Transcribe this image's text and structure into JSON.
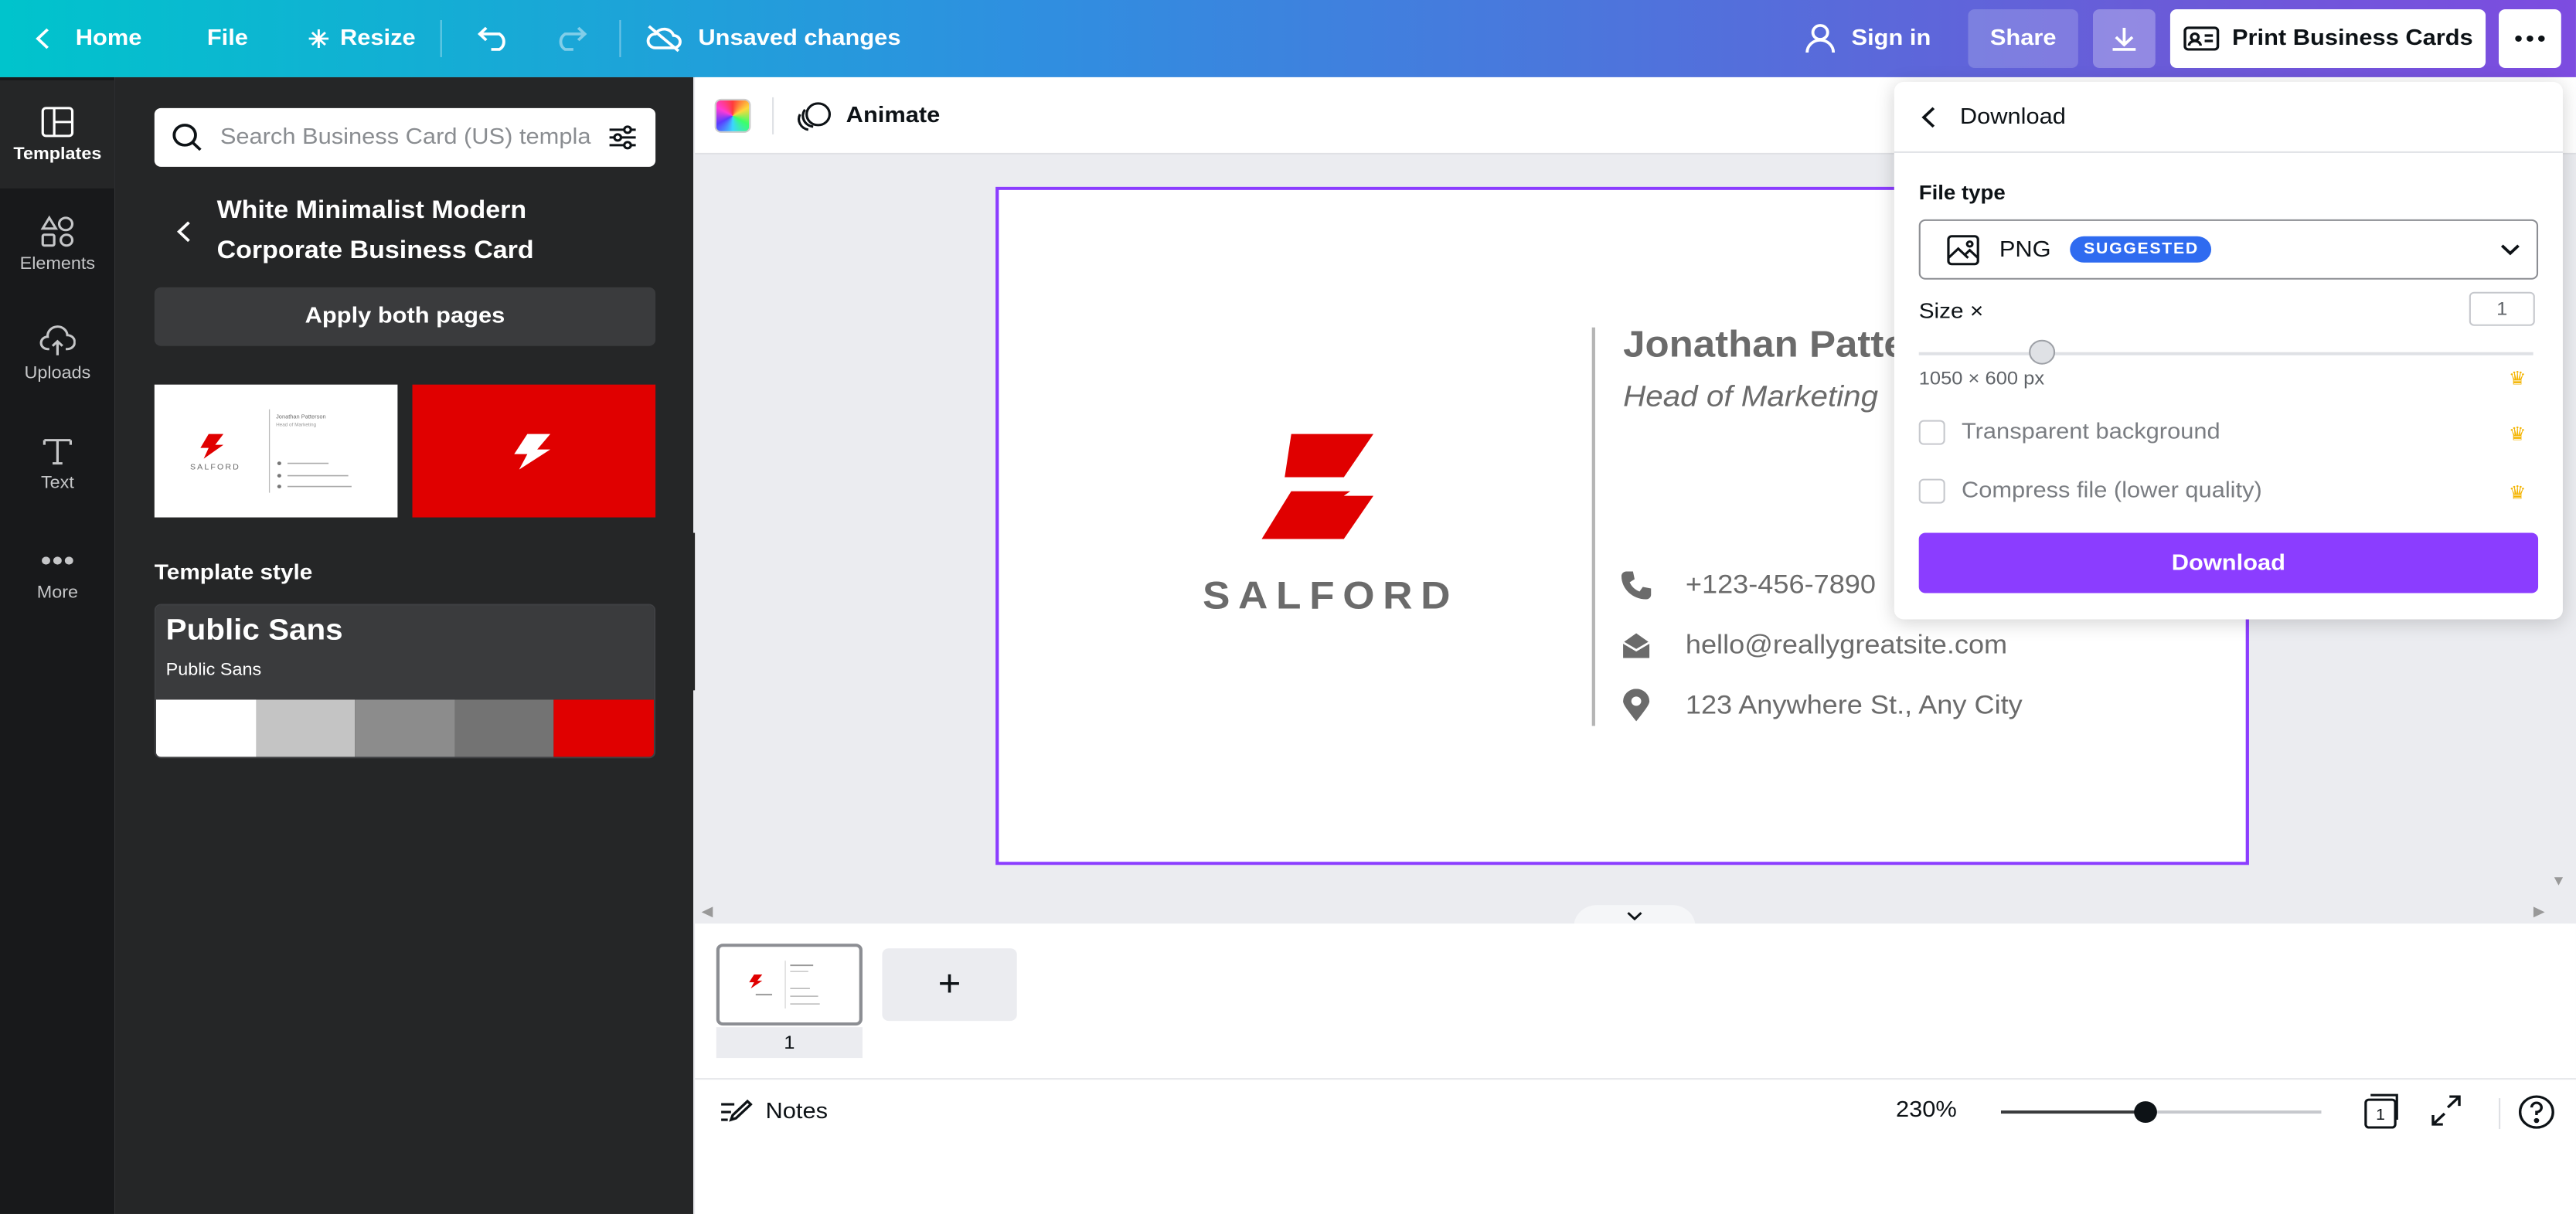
{
  "topbar": {
    "home": "Home",
    "file": "File",
    "resize": "Resize",
    "status": "Unsaved changes",
    "sign_in": "Sign in",
    "share": "Share",
    "print": "Print Business Cards"
  },
  "rail": {
    "items": [
      {
        "label": "Templates",
        "icon": "templates-icon"
      },
      {
        "label": "Elements",
        "icon": "elements-icon"
      },
      {
        "label": "Uploads",
        "icon": "uploads-icon"
      },
      {
        "label": "Text",
        "icon": "text-icon"
      },
      {
        "label": "More",
        "icon": "more-icon"
      }
    ]
  },
  "panel": {
    "search_placeholder": "Search Business Card (US) templa",
    "template_title": "White Minimalist Modern Corporate Business Card",
    "apply": "Apply both pages",
    "template_style_label": "Template style",
    "style_heading": "Public Sans",
    "style_sub": "Public Sans",
    "swatches": [
      "#ffffff",
      "#c4c4c4",
      "#8c8c8c",
      "#737373",
      "#e00000"
    ],
    "thumb_name": "Jonathan Patterson",
    "thumb_role": "Head of Marketing"
  },
  "toolbar": {
    "animate": "Animate"
  },
  "card": {
    "brand": "SALFORD",
    "name": "Jonathan Patterson",
    "role": "Head of Marketing",
    "phone": "+123-456-7890",
    "email": "hello@reallygreatsite.com",
    "address": "123 Anywhere St., Any City",
    "accent": "#e00000",
    "text_color": "#6b6b6b"
  },
  "pages": {
    "current": "1",
    "add": "+"
  },
  "footer": {
    "notes": "Notes",
    "zoom": "230%",
    "zoom_level": 0.45,
    "page_count": "1"
  },
  "download": {
    "title": "Download",
    "file_type_label": "File type",
    "file_type": "PNG",
    "badge": "SUGGESTED",
    "size_label": "Size ×",
    "size_value": "1",
    "size_level": 0.2,
    "dimensions": "1050 × 600 px",
    "transparent": "Transparent background",
    "compress": "Compress file (lower quality)",
    "button": "Download"
  },
  "colors": {
    "brand_purple": "#8b3dff",
    "badge_blue": "#2f6bf0",
    "crown": "#f4b400"
  }
}
